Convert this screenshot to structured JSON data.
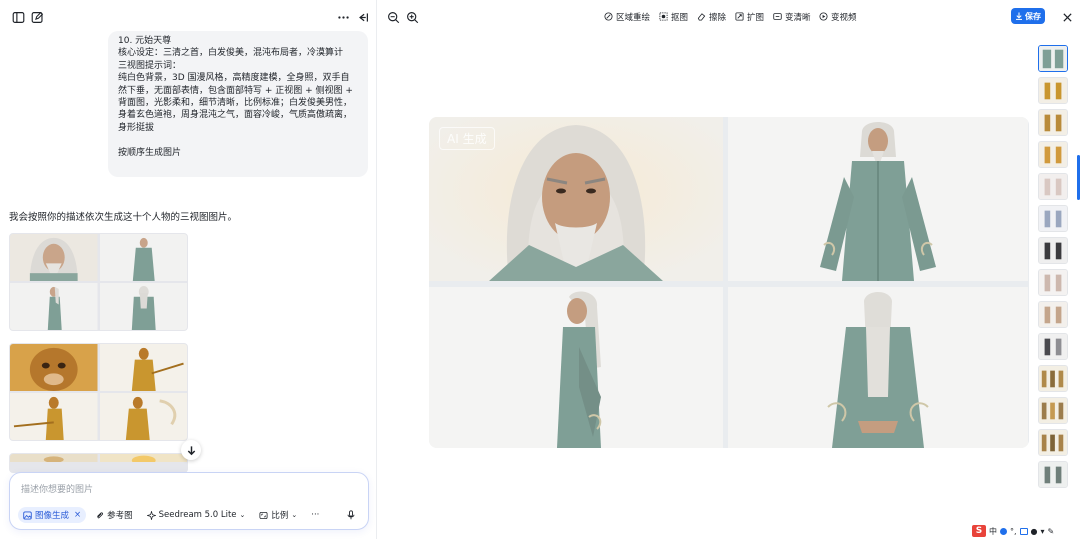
{
  "left_toolbar": {
    "sidebar_icon": "sidebar-toggle-icon",
    "new_chat_icon": "edit-icon",
    "more_icon": "more-horizontal-icon",
    "collapse_icon": "collapse-left-icon"
  },
  "prompt_bubble": {
    "lines": [
      "10. 元始天尊",
      "核心设定：三清之首，白发俊美，混沌布局者，冷漠算计",
      "三视图提示词：",
      "纯白色背景，3D 国漫风格，高精度建模，全身照，双手自然下垂，无面部表情，包含面部特写 + 正视图 + 侧视图 + 背面图，光影柔和，细节清晰，比例标准；白发俊美男性，身着玄色道袍，周身混沌之气，面容冷峻，气质高傲疏离，身形挺拔",
      "",
      "按顺序生成图片"
    ]
  },
  "reply_text": "我会按照你的描述依次生成这十个人物的三视图图片。",
  "composer": {
    "placeholder": "描述你想要的图片",
    "mode_chip": "图像生成",
    "reference_chip": "参考图",
    "model_chip": "Seedream 5.0 Lite",
    "ratio_chip": "比例",
    "more_chip": "···"
  },
  "right_toolbar": {
    "zoom_out_icon": "zoom-out-icon",
    "zoom_in_icon": "zoom-in-icon",
    "tools": [
      "区域重绘",
      "抠图",
      "擦除",
      "扩图",
      "变清晰",
      "变视频"
    ],
    "save_label": "保存",
    "close_icon": "close-icon"
  },
  "viewer": {
    "watermark": "AI 生成"
  },
  "colors": {
    "accent": "#1f6feb",
    "robe": "#7f9f96",
    "gold": "#c9962f"
  }
}
